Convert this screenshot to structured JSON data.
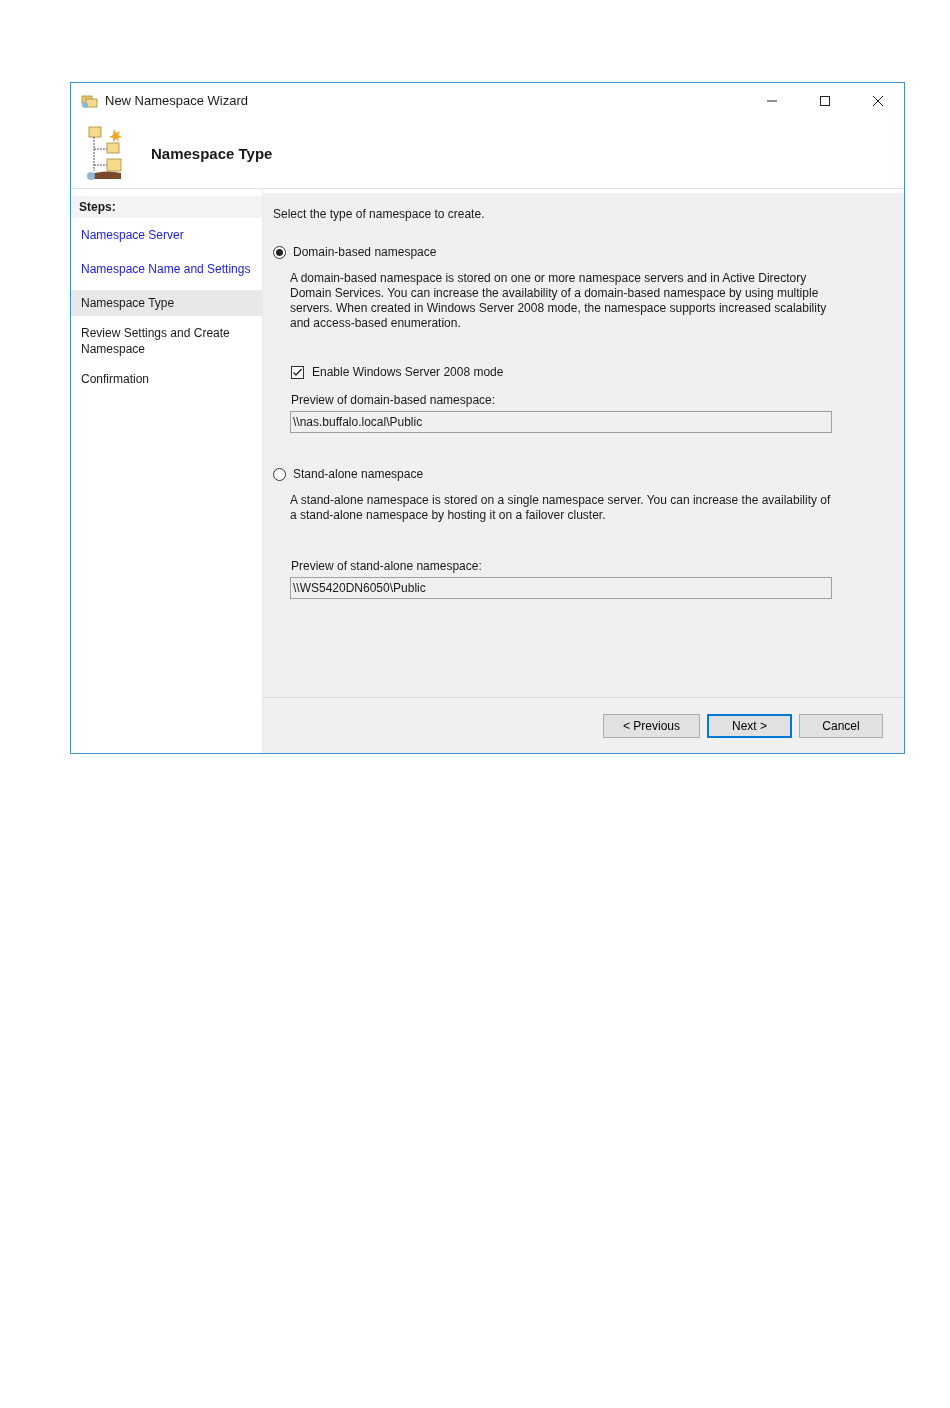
{
  "window": {
    "title": "New Namespace Wizard"
  },
  "header": {
    "title": "Namespace Type"
  },
  "steps": {
    "heading": "Steps:",
    "items": [
      {
        "label": "Namespace Server",
        "kind": "done",
        "selected": false
      },
      {
        "label": "Namespace Name and Settings",
        "kind": "done",
        "selected": false
      },
      {
        "label": "Namespace Type",
        "kind": "current",
        "selected": true
      },
      {
        "label": "Review Settings and Create Namespace",
        "kind": "pending",
        "selected": false
      },
      {
        "label": "Confirmation",
        "kind": "pending",
        "selected": false
      }
    ]
  },
  "content": {
    "instruction": "Select the type of namespace to create.",
    "options": [
      {
        "label": "Domain-based namespace",
        "selected": true,
        "description": "A domain-based namespace is stored on one or more namespace servers and in Active Directory Domain Services. You can increase the availability of a domain-based namespace by using multiple servers. When created in Windows Server 2008 mode, the namespace supports increased scalability and access-based enumeration.",
        "checkbox": {
          "label": "Enable Windows Server 2008 mode",
          "checked": true
        },
        "preview_label": "Preview of domain-based namespace:",
        "preview_value": "\\\\nas.buffalo.local\\Public"
      },
      {
        "label": "Stand-alone namespace",
        "selected": false,
        "description": "A stand-alone namespace is stored on a single namespace server. You can increase the availability of a stand-alone namespace by hosting it on a failover cluster.",
        "preview_label": "Preview of stand-alone namespace:",
        "preview_value": "\\\\WS5420DN6050\\Public"
      }
    ]
  },
  "buttons": [
    {
      "label": "< Previous",
      "kind": "normal"
    },
    {
      "label": "Next >",
      "kind": "default"
    },
    {
      "label": "Cancel",
      "kind": "normal"
    }
  ]
}
